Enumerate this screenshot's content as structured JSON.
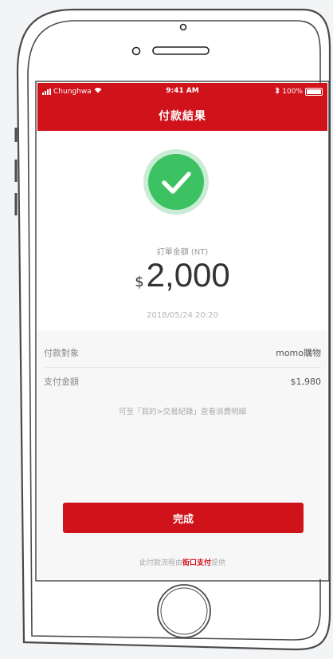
{
  "status_bar": {
    "carrier": "Chunghwa",
    "time": "9:41 AM",
    "battery": "100%",
    "bluetooth_icon": "bluetooth-icon",
    "wifi_icon": "wifi-icon"
  },
  "nav": {
    "title": "付款結果"
  },
  "result": {
    "icon": "checkmark-icon",
    "amount_label": "訂單金額 (NT)",
    "currency_symbol": "$",
    "amount": "2,000",
    "datetime": "2018/05/24 20:20"
  },
  "details": [
    {
      "label": "付款對象",
      "value": "momo購物"
    },
    {
      "label": "支付金額",
      "value": "$1,980"
    }
  ],
  "note": "可至「我的>交易紀錄」查看消費明細",
  "done_button": {
    "label": "完成"
  },
  "footer": {
    "prefix": "此付款流程由",
    "brand": "街口支付",
    "suffix": "提供"
  },
  "colors": {
    "brand_red": "#d0121b",
    "success_green": "#3cc262",
    "success_green_light": "#c9ecd5"
  }
}
